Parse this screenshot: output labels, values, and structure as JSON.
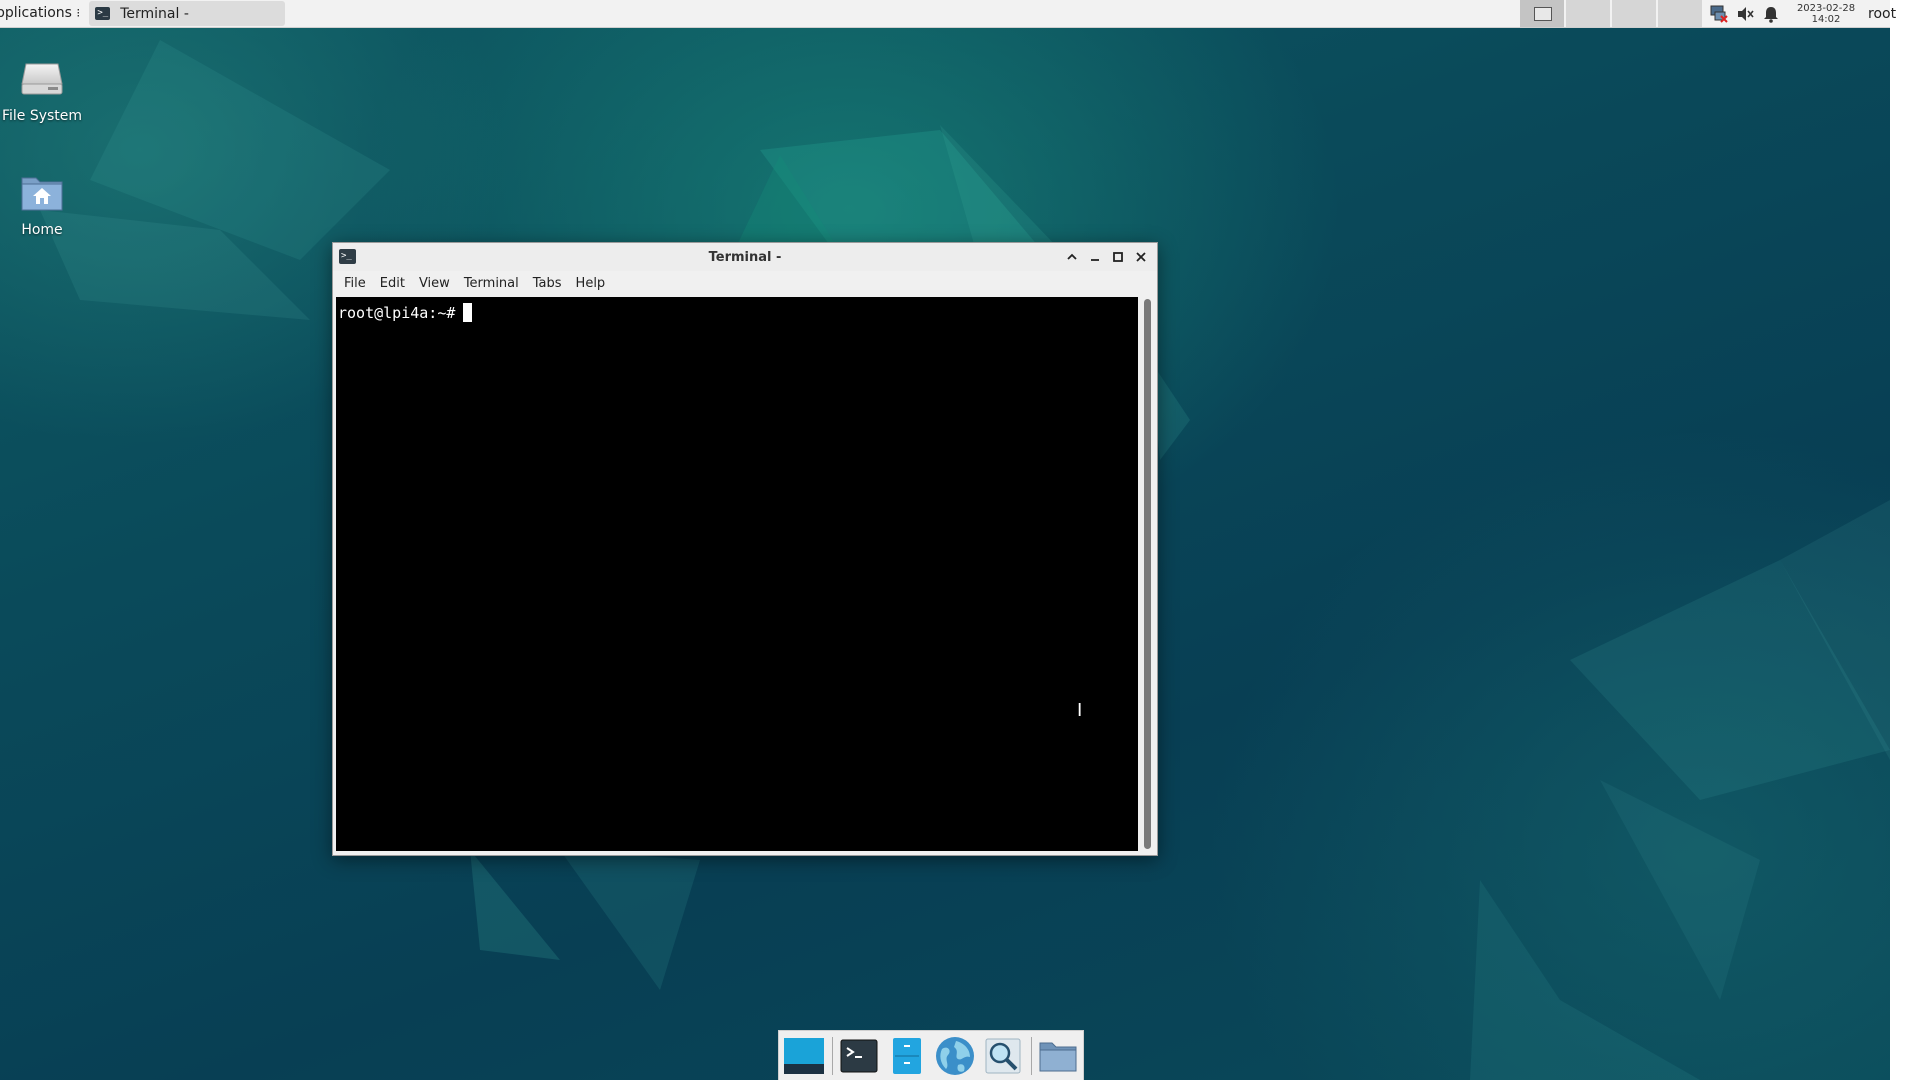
{
  "top_panel": {
    "applications_label": "pplications",
    "task_title": "Terminal -",
    "clock_date": "2023-02-28",
    "clock_time": "14:02",
    "user": "root"
  },
  "desktop": {
    "icons": [
      {
        "label": "File System",
        "icon": "drive-icon"
      },
      {
        "label": "Home",
        "icon": "home-folder-icon"
      }
    ]
  },
  "terminal": {
    "title": "Terminal -",
    "menu": [
      "File",
      "Edit",
      "View",
      "Terminal",
      "Tabs",
      "Help"
    ],
    "prompt": "root@lpi4a:~#"
  },
  "dock": {
    "items": [
      "show-desktop-icon",
      "terminal-icon",
      "file-manager-icon",
      "web-browser-icon",
      "app-finder-icon",
      "folder-icon"
    ]
  }
}
